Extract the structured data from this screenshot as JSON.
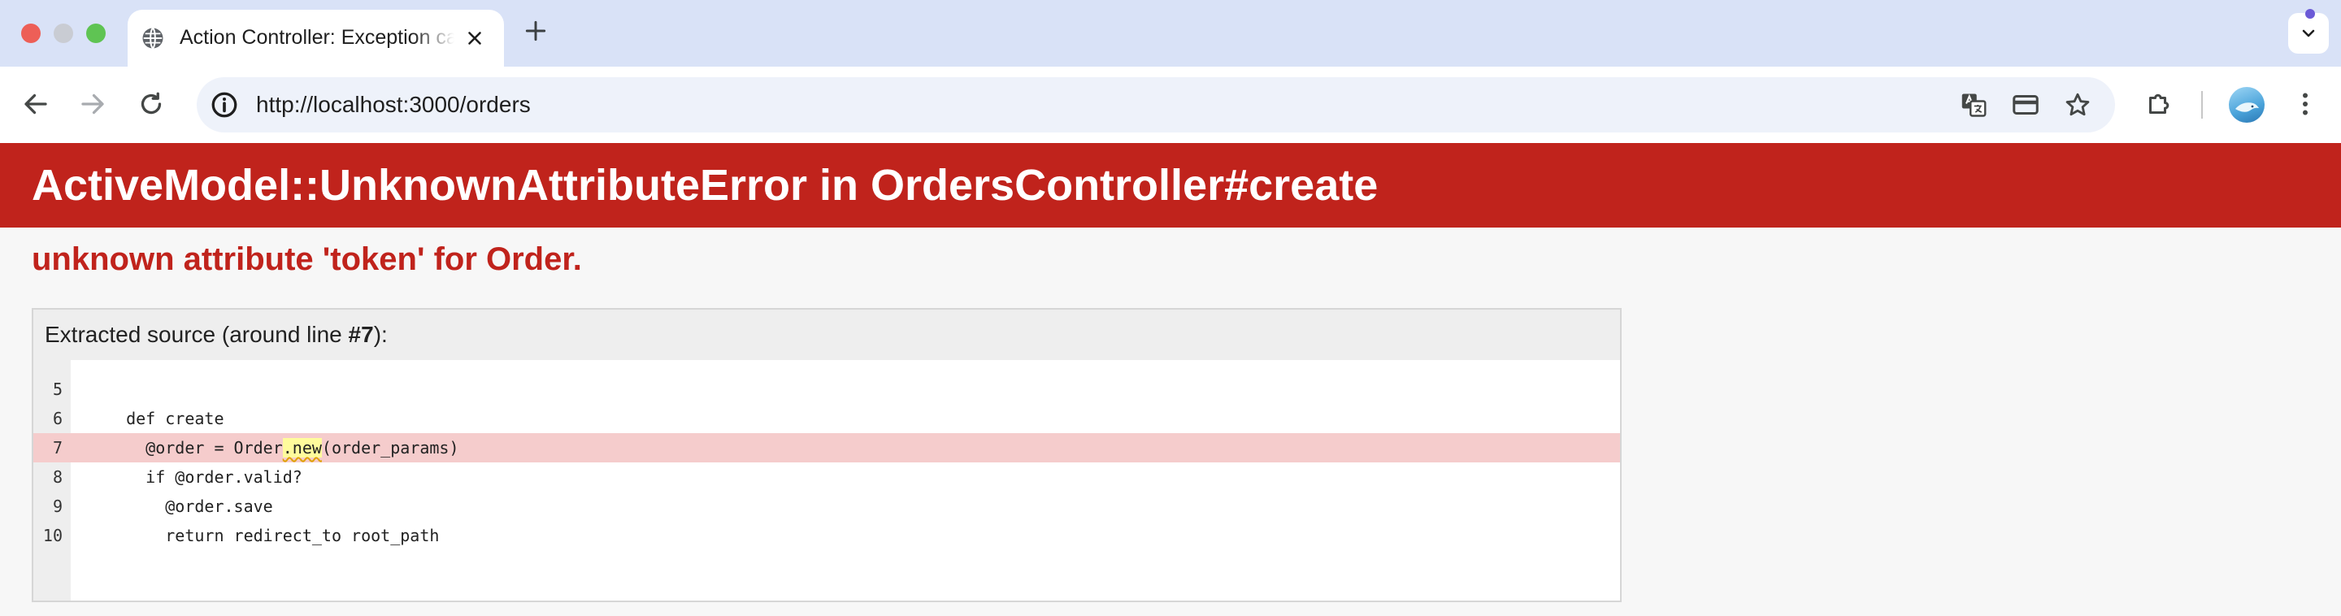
{
  "browser": {
    "tab": {
      "title": "Action Controller: Exception caught",
      "favicon": "globe-icon",
      "close_icon": "close-icon"
    },
    "new_tab_icon": "plus-icon",
    "tab_menu_icon": "chevron-down-icon",
    "toolbar": {
      "back_icon": "arrow-left-icon",
      "forward_icon": "arrow-right-icon",
      "reload_icon": "reload-icon",
      "site_info_icon": "info-icon",
      "url": "http://localhost:3000/orders",
      "translate_icon": "translate-icon",
      "payment_icon": "credit-card-icon",
      "bookmark_icon": "star-icon",
      "extensions_icon": "puzzle-icon",
      "profile_icon": "avatar",
      "menu_icon": "kebab-menu-icon"
    },
    "colors": {
      "tabstrip": "#d9e2f7",
      "omnibox": "#eef2fa"
    }
  },
  "error_page": {
    "title": "ActiveModel::UnknownAttributeError in OrdersController#create",
    "message": "unknown attribute 'token' for Order.",
    "source": {
      "caption_prefix": "Extracted source (around line ",
      "caption_line": "#7",
      "caption_suffix": "):",
      "lines": [
        {
          "no": "5",
          "code": ""
        },
        {
          "no": "6",
          "code": "  def create"
        },
        {
          "no": "7",
          "code_before": "    @order = Order",
          "code_highlight": ".new",
          "code_after": "(order_params)"
        },
        {
          "no": "8",
          "code": "    if @order.valid?"
        },
        {
          "no": "9",
          "code": "      @order.save"
        },
        {
          "no": "10",
          "code": "      return redirect_to root_path"
        }
      ]
    },
    "colors": {
      "header_bg": "#c0231c",
      "message_text": "#c0231c",
      "highlight_line": "#f5cccc",
      "highlight_token": "#fffb9c"
    }
  }
}
